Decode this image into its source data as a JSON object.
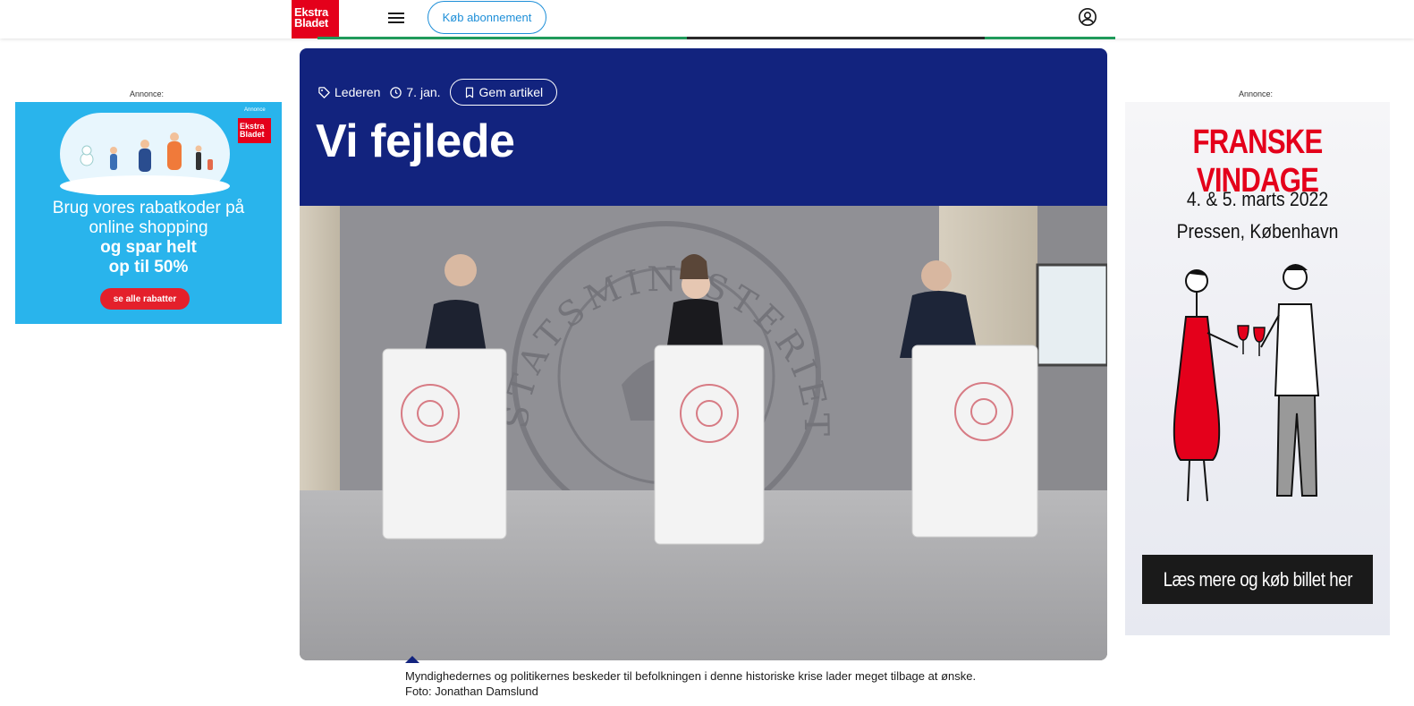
{
  "header": {
    "logo_line1": "Ekstra",
    "logo_line2": "Bladet",
    "subscribe_label": "Køb abonnement"
  },
  "ads": {
    "label": "Annonce:",
    "left": {
      "mini_label": "Annonce",
      "logo_line1": "Ekstra",
      "logo_line2": "Bladet",
      "line1": "Brug vores rabatkoder på",
      "line2": "online shopping",
      "line3": "og spar helt",
      "line4": "op til 50%",
      "cta": "se alle rabatter"
    },
    "right": {
      "title": "FRANSKE VINDAGE",
      "date": "4. & 5. marts 2022",
      "venue": "Pressen, København",
      "cta": "Læs mere og køb billet her"
    }
  },
  "article": {
    "tag": "Lederen",
    "date": "7. jan.",
    "save_label": "Gem artikel",
    "headline": "Vi fejlede",
    "caption": "Myndighedernes og politikernes beskeder til befolkningen i denne historiske krise lader meget tilbage at ønske. Foto: Jonathan Damslund",
    "photo_wall_text": "STATSMINISTERIET"
  },
  "colors": {
    "brand_red": "#e4001b",
    "navy": "#12237e",
    "subscribe_blue": "#1e8fd8",
    "ad_blue": "#29b4ec"
  }
}
